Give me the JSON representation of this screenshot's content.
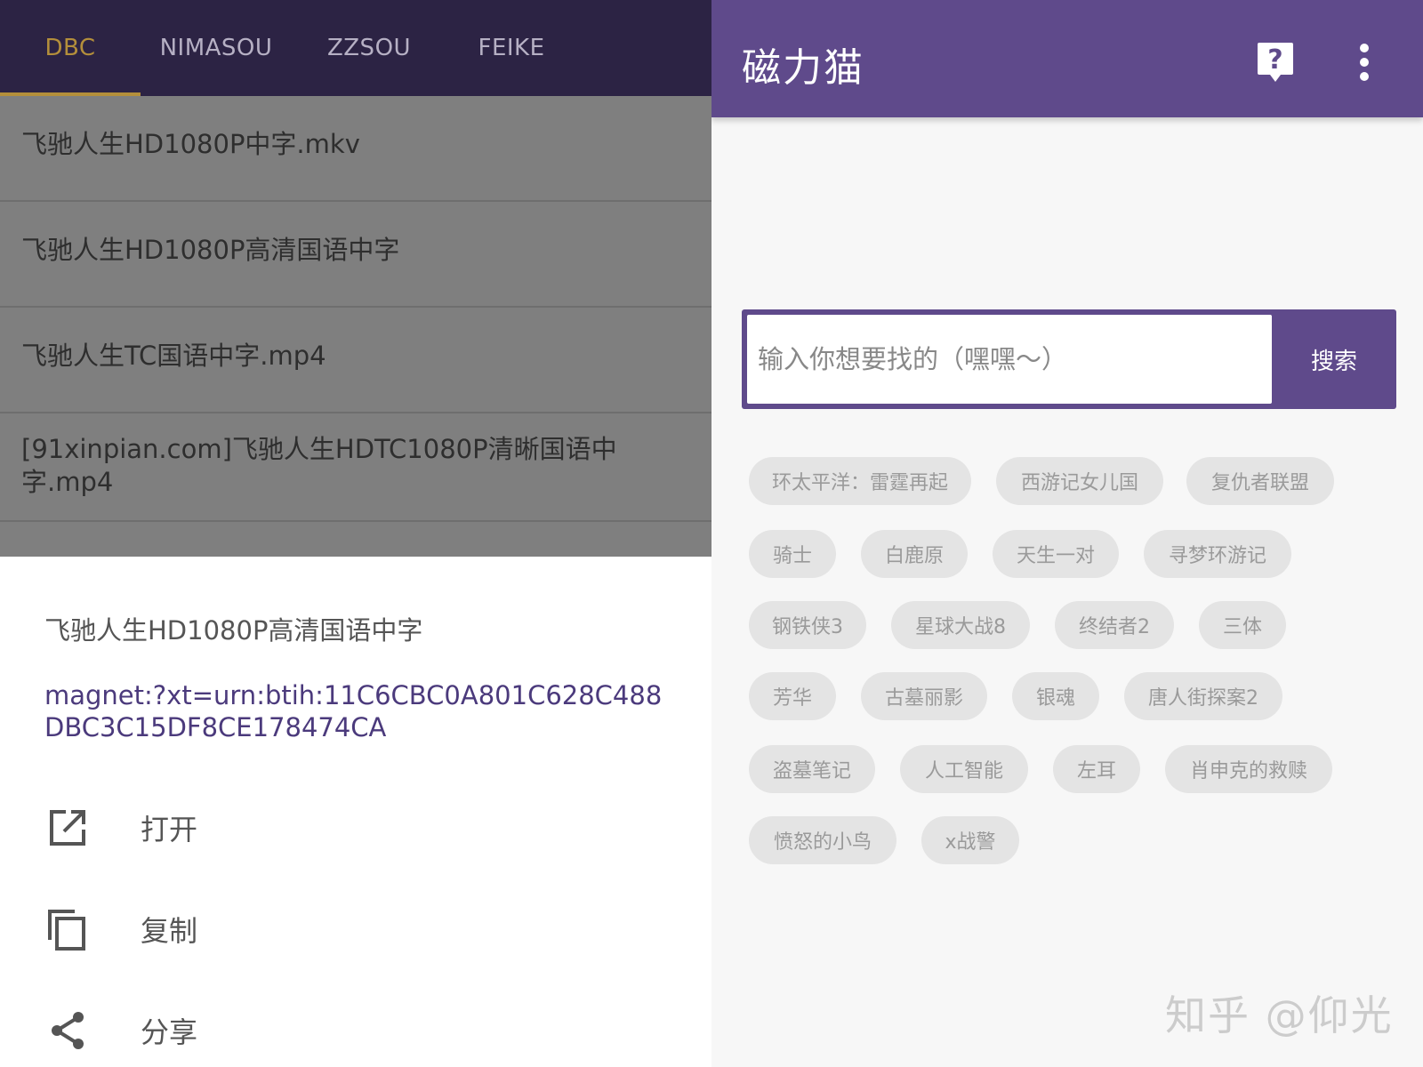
{
  "left": {
    "tabs": [
      "DBC",
      "NIMASOU",
      "ZZSOU",
      "FEIKE"
    ],
    "results": [
      "飞驰人生HD1080P中字.mkv",
      "飞驰人生HD1080P高清国语中字",
      "飞驰人生TC国语中字.mp4",
      "[91xinpian.com]飞驰人生HDTC1080P清晰国语中字.mp4"
    ],
    "sheet": {
      "title": "飞驰人生HD1080P高清国语中字",
      "magnet": "magnet:?xt=urn:btih:11C6CBC0A801C628C488DBC3C15DF8CE178474CA",
      "actions": [
        {
          "label": "打开",
          "icon": "open-external-icon"
        },
        {
          "label": "复制",
          "icon": "copy-icon"
        },
        {
          "label": "分享",
          "icon": "share-icon"
        }
      ]
    }
  },
  "right": {
    "app_title": "磁力猫",
    "search": {
      "placeholder": "输入你想要找的（嘿嘿～）",
      "button": "搜索"
    },
    "chips": [
      "环太平洋：雷霆再起",
      "西游记女儿国",
      "复仇者联盟",
      "骑士",
      "白鹿原",
      "天生一对",
      "寻梦环游记",
      "钢铁侠3",
      "星球大战8",
      "终结者2",
      "三体",
      "芳华",
      "古墓丽影",
      "银魂",
      "唐人街探案2",
      "盗墓笔记",
      "人工智能",
      "左耳",
      "肖申克的救赎",
      "愤怒的小鸟",
      "x战警"
    ],
    "watermark": "知乎 @仰光"
  },
  "colors": {
    "tabbar": "#2c2344",
    "tab_active": "#b48f3b",
    "accent": "#5f4a8b",
    "magnet_text": "#4b3a7c",
    "chip_bg": "#e4e4e4"
  }
}
